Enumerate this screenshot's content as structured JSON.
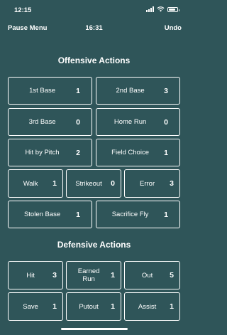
{
  "status": {
    "time": "12:15"
  },
  "nav": {
    "left": "Pause Menu",
    "center": "16:31",
    "right": "Undo"
  },
  "offensive": {
    "title": "Offensive Actions",
    "buttons": [
      {
        "label": "1st Base",
        "value": "1"
      },
      {
        "label": "2nd Base",
        "value": "3"
      },
      {
        "label": "3rd Base",
        "value": "0"
      },
      {
        "label": "Home Run",
        "value": "0"
      },
      {
        "label": "Hit by Pitch",
        "value": "2"
      },
      {
        "label": "Field Choice",
        "value": "1"
      },
      {
        "label": "Walk",
        "value": "1"
      },
      {
        "label": "Strikeout",
        "value": "0"
      },
      {
        "label": "Error",
        "value": "3"
      },
      {
        "label": "Stolen Base",
        "value": "1"
      },
      {
        "label": "Sacrifice Fly",
        "value": "1"
      }
    ]
  },
  "defensive": {
    "title": "Defensive Actions",
    "buttons": [
      {
        "label": "Hit",
        "value": "3"
      },
      {
        "label": "Earned Run",
        "value": "1"
      },
      {
        "label": "Out",
        "value": "5"
      },
      {
        "label": "Save",
        "value": "1"
      },
      {
        "label": "Putout",
        "value": "1"
      },
      {
        "label": "Assist",
        "value": "1"
      }
    ]
  }
}
